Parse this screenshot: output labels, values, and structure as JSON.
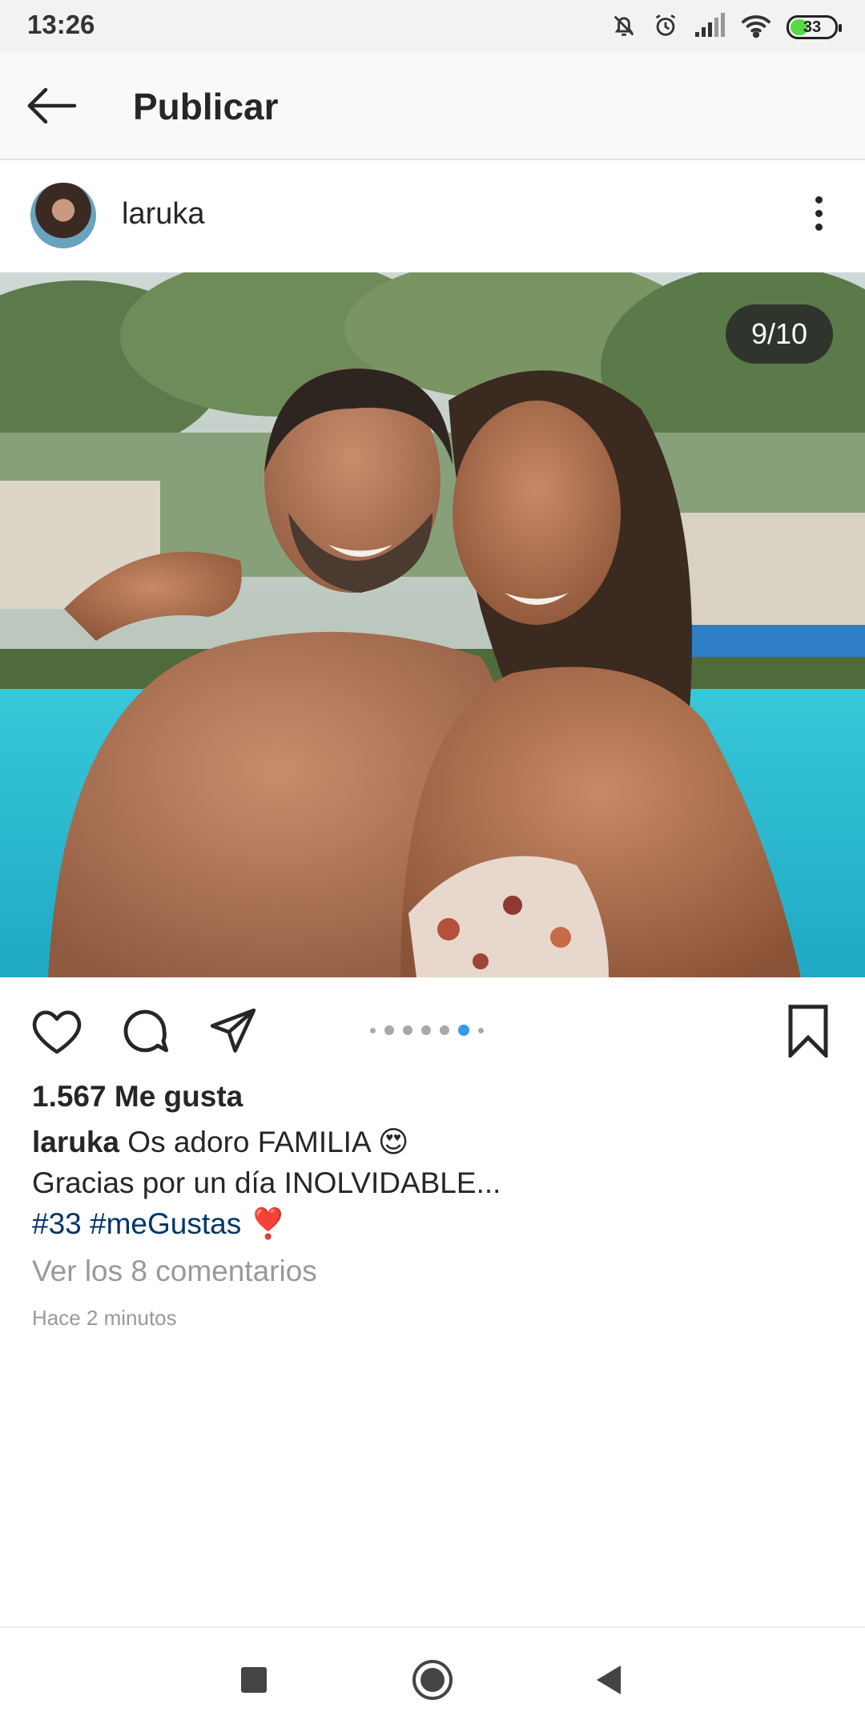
{
  "status_bar": {
    "time": "13:26",
    "battery": "33",
    "icons": [
      "mute-bell-icon",
      "alarm-icon",
      "signal-icon",
      "wifi-icon",
      "battery-icon"
    ]
  },
  "header": {
    "title": "Publicar",
    "back_icon": "arrow-left-icon"
  },
  "post": {
    "username": "laruka",
    "more_icon": "vertical-dots-icon",
    "counter": "9/10",
    "carousel": {
      "total_dots": 7,
      "active_index": 5
    },
    "likes": "1.567 Me gusta",
    "caption": {
      "user": "laruka",
      "line1": "Os adoro FAMILIA",
      "emoji1": "😍",
      "line2": "Gracias por un día INOLVIDABLE...",
      "hashtag1": "#33",
      "hashtag2": "#meGustas",
      "emoji2": "❣️"
    },
    "view_comments": "Ver los 8 comentarios",
    "timestamp": "Hace 2 minutos"
  },
  "actions": {
    "icons": [
      "heart-icon",
      "comment-icon",
      "send-icon",
      "bookmark-icon"
    ]
  },
  "colors": {
    "accent_blue": "#3897f0",
    "hashtag": "#003569",
    "muted_text": "#999999",
    "battery_green": "#5ad84a"
  },
  "nav": {
    "icons": [
      "recents-square-icon",
      "home-circle-icon",
      "back-triangle-icon"
    ]
  }
}
